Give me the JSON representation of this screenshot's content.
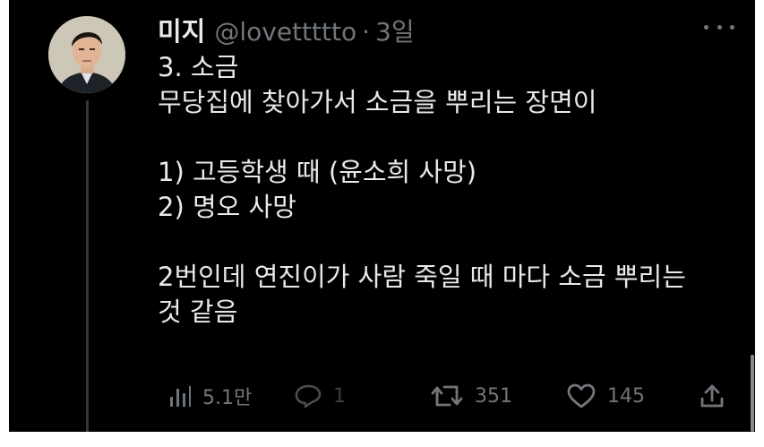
{
  "tweet": {
    "author_name": "미지",
    "handle": "@lovettttto",
    "separator": "·",
    "time": "3일",
    "lines": {
      "l1": "3. 소금",
      "l2": "무당집에 찾아가서 소금을 뿌리는 장면이",
      "l3": "1) 고등학생 때 (윤소희 사망)",
      "l4": "2) 명오 사망",
      "l5": "2번인데 연진이가 사람 죽일 때 마다 소금 뿌리는",
      "l6": "것 같음"
    }
  },
  "actions": {
    "views": "5.1만",
    "replies": "1",
    "retweets": "351",
    "likes": "145"
  },
  "icons": {
    "views": "bar-chart-icon",
    "reply": "speech-bubble-icon",
    "retweet": "retweet-icon",
    "like": "heart-icon",
    "share": "share-upload-icon",
    "more": "more-dots-icon"
  },
  "colors": {
    "background": "#000000",
    "text": "#e7e9ea",
    "muted": "#71767b",
    "thread_line": "#343638"
  }
}
